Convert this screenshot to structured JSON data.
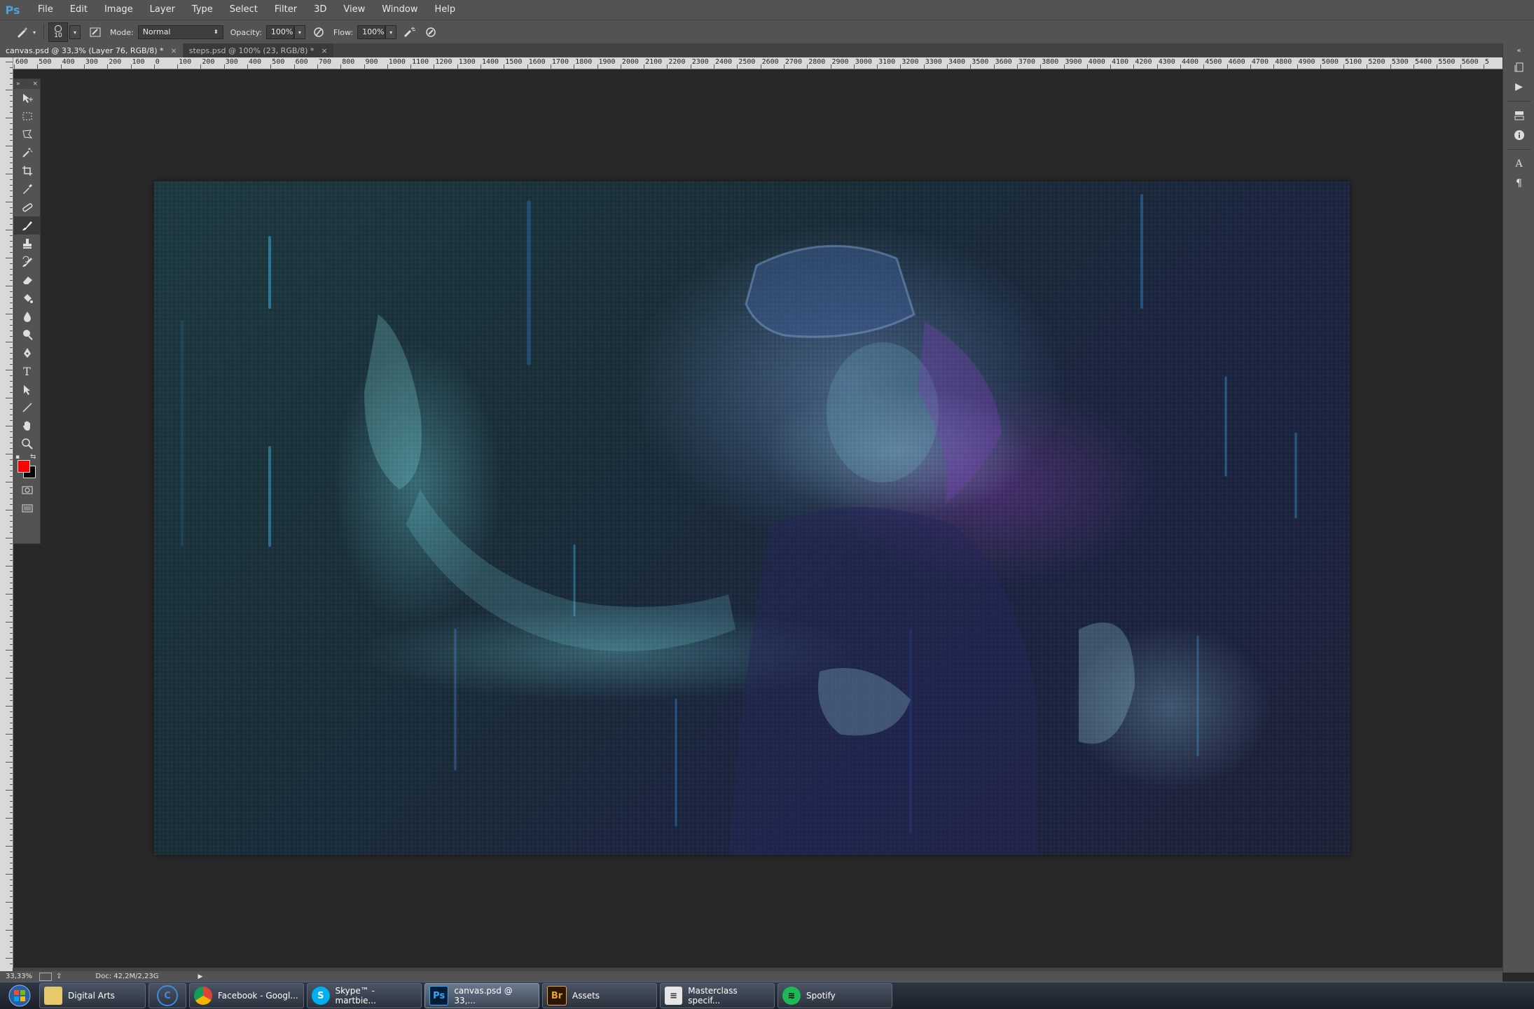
{
  "app": {
    "logo": "Ps"
  },
  "menu": [
    "File",
    "Edit",
    "Image",
    "Layer",
    "Type",
    "Select",
    "Filter",
    "3D",
    "View",
    "Window",
    "Help"
  ],
  "options": {
    "brush_size": "10",
    "mode_label": "Mode:",
    "mode_value": "Normal",
    "opacity_label": "Opacity:",
    "opacity_value": "100%",
    "flow_label": "Flow:",
    "flow_value": "100%"
  },
  "tabs": [
    {
      "label": "canvas.psd @ 33,3% (Layer 76, RGB/8) *",
      "close": "×",
      "active": true
    },
    {
      "label": "steps.psd @ 100% (23, RGB/8) *",
      "close": "×",
      "active": false
    }
  ],
  "ruler_top": [
    "600",
    "500",
    "400",
    "300",
    "200",
    "100",
    "0",
    "100",
    "200",
    "300",
    "400",
    "500",
    "600",
    "700",
    "800",
    "900",
    "1000",
    "1100",
    "1200",
    "1300",
    "1400",
    "1500",
    "1600",
    "1700",
    "1800",
    "1900",
    "2000",
    "2100",
    "2200",
    "2300",
    "2400",
    "2500",
    "2600",
    "2700",
    "2800",
    "2900",
    "3000",
    "3100",
    "3200",
    "3300",
    "3400",
    "3500",
    "3600",
    "3700",
    "3800",
    "3900",
    "4000",
    "4100",
    "4200",
    "4300",
    "4400",
    "4500",
    "4600",
    "4700",
    "4800",
    "4900",
    "5000",
    "5100",
    "5200",
    "5300",
    "5400",
    "5500",
    "5600",
    "5"
  ],
  "tools": [
    "move-tool",
    "marquee-tool",
    "lasso-tool",
    "magic-wand-tool",
    "crop-tool",
    "eyedropper-tool",
    "healing-brush-tool",
    "brush-tool",
    "clone-stamp-tool",
    "history-brush-tool",
    "eraser-tool",
    "paint-bucket-tool",
    "blur-tool",
    "dodge-tool",
    "pen-tool",
    "type-tool",
    "path-selection-tool",
    "line-tool",
    "hand-tool",
    "zoom-tool"
  ],
  "colors": {
    "foreground": "#ff0000",
    "background": "#000000"
  },
  "status": {
    "zoom": "33,33%",
    "doc": "Doc: 42,2M/2,23G"
  },
  "taskbar": [
    {
      "label": "Digital Arts",
      "icon": "folder-icon",
      "active": false
    },
    {
      "label": "Facebook - Googl...",
      "icon": "chrome-icon",
      "active": false
    },
    {
      "label": "Skype™ - martbie...",
      "icon": "skype-icon",
      "active": false
    },
    {
      "label": "canvas.psd @ 33,...",
      "icon": "photoshop-icon",
      "active": true
    },
    {
      "label": "Assets",
      "icon": "bridge-icon",
      "active": false
    },
    {
      "label": "Masterclass specif...",
      "icon": "document-icon",
      "active": false
    },
    {
      "label": "Spotify",
      "icon": "spotify-icon",
      "active": false
    }
  ]
}
